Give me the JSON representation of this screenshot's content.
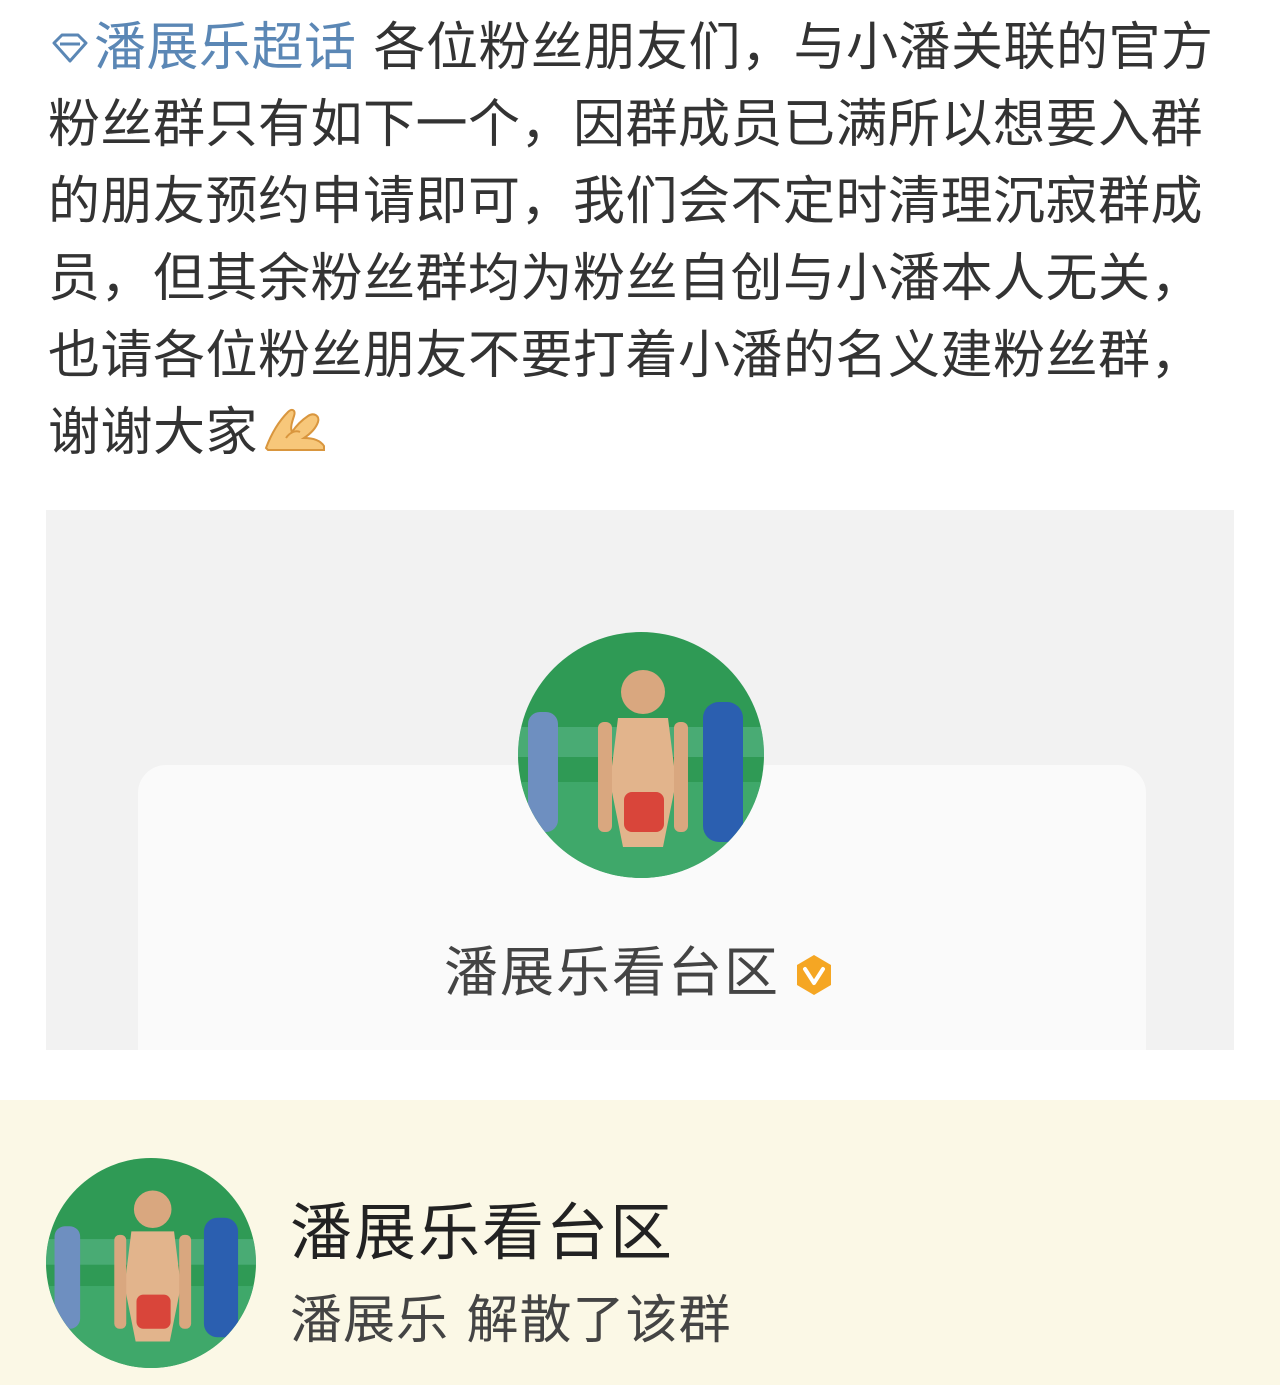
{
  "post": {
    "topic_label": "潘展乐超话",
    "body": " 各位粉丝朋友们，与小潘关联的官方粉丝群只有如下一个，因群成员已满所以想要入群的朋友预约申请即可，我们会不定时清理沉寂群成员，但其余粉丝群均为粉丝自创与小潘本人无关，也请各位粉丝朋友不要打着小潘的名义建粉丝群，谢谢大家",
    "emoji": "ok-hand-emoji",
    "topic_icon": "diamond-icon"
  },
  "screenshot_card": {
    "group_name": "潘展乐看台区",
    "badge_icon": "verified-v-badge-icon",
    "badge_color": "#f5a623"
  },
  "chat_item": {
    "group_name": "潘展乐看台区",
    "status": "潘展乐 解散了该群"
  },
  "colors": {
    "topic_link": "#5b87b5",
    "chat_bg": "#fbf8e6",
    "card_bg": "#f2f2f2"
  }
}
